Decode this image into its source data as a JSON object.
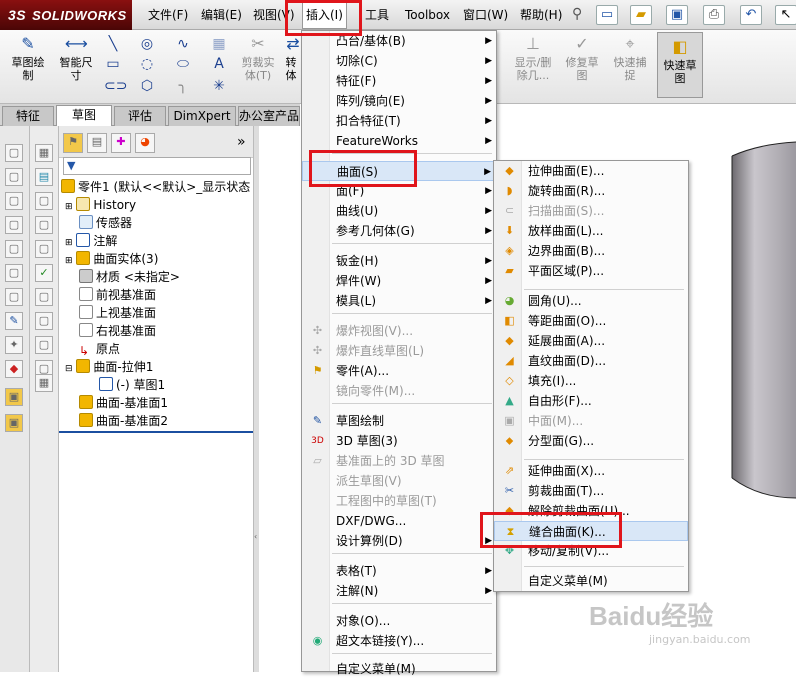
{
  "app": {
    "brand_prefix": "3S",
    "brand": "SOLIDWORKS"
  },
  "menubar": [
    {
      "label": "文件(F)"
    },
    {
      "label": "编辑(E)"
    },
    {
      "label": "视图(V)"
    },
    {
      "label": "插入(I)"
    },
    {
      "label": "工具"
    },
    {
      "label": "Toolbox"
    },
    {
      "label": "窗口(W)"
    },
    {
      "label": "帮助(H)"
    }
  ],
  "commandbar": {
    "sketch": "草图绘\n制",
    "smart_dim": "智能尺\n寸",
    "trim": "剪裁实\n体(T)",
    "convert": "转\n体",
    "show_hide": "显示/删\n除几...",
    "repair_sketch": "修复草\n图",
    "quick_snap": "快速捕\n捉",
    "quick_sketch": "快速草\n图"
  },
  "tabs": [
    {
      "label": "特征"
    },
    {
      "label": "草图"
    },
    {
      "label": "评估"
    },
    {
      "label": "DimXpert"
    },
    {
      "label": "办公室产品"
    }
  ],
  "tree": {
    "root": "零件1 (默认<<默认>_显示状态",
    "items": [
      {
        "label": "History"
      },
      {
        "label": "传感器"
      },
      {
        "label": "注解"
      },
      {
        "label": "曲面实体(3)"
      },
      {
        "label": "材质 <未指定>"
      },
      {
        "label": "前视基准面"
      },
      {
        "label": "上视基准面"
      },
      {
        "label": "右视基准面"
      },
      {
        "label": "原点"
      },
      {
        "label": "曲面-拉伸1"
      },
      {
        "label": "(-) 草图1"
      },
      {
        "label": "曲面-基准面1"
      },
      {
        "label": "曲面-基准面2"
      }
    ]
  },
  "insert_menu": [
    {
      "label": "凸台/基体(B)",
      "sub": true
    },
    {
      "label": "切除(C)",
      "sub": true
    },
    {
      "label": "特征(F)",
      "sub": true
    },
    {
      "label": "阵列/镜向(E)",
      "sub": true
    },
    {
      "label": "扣合特征(T)",
      "sub": true
    },
    {
      "label": "FeatureWorks",
      "sub": true
    },
    {
      "label": "曲面(S)",
      "sub": true
    },
    {
      "label": "面(F)",
      "sub": true
    },
    {
      "label": "曲线(U)",
      "sub": true
    },
    {
      "label": "参考几何体(G)",
      "sub": true
    },
    {
      "label": "钣金(H)",
      "sub": true
    },
    {
      "label": "焊件(W)",
      "sub": true
    },
    {
      "label": "模具(L)",
      "sub": true
    },
    {
      "label": "爆炸视图(V)..."
    },
    {
      "label": "爆炸直线草图(L)"
    },
    {
      "label": "零件(A)..."
    },
    {
      "label": "镜向零件(M)..."
    },
    {
      "label": "草图绘制"
    },
    {
      "label": "3D 草图(3)"
    },
    {
      "label": "基准面上的 3D 草图"
    },
    {
      "label": "派生草图(V)"
    },
    {
      "label": "工程图中的草图(T)"
    },
    {
      "label": "DXF/DWG..."
    },
    {
      "label": "设计算例(D)",
      "sub": true
    },
    {
      "label": "表格(T)",
      "sub": true
    },
    {
      "label": "注解(N)",
      "sub": true
    },
    {
      "label": "对象(O)..."
    },
    {
      "label": "超文本链接(Y)..."
    },
    {
      "label": "自定义菜单(M)"
    }
  ],
  "surface_menu": [
    {
      "label": "拉伸曲面(E)..."
    },
    {
      "label": "旋转曲面(R)..."
    },
    {
      "label": "扫描曲面(S)..."
    },
    {
      "label": "放样曲面(L)..."
    },
    {
      "label": "边界曲面(B)..."
    },
    {
      "label": "平面区域(P)..."
    },
    {
      "label": "圆角(U)..."
    },
    {
      "label": "等距曲面(O)..."
    },
    {
      "label": "延展曲面(A)..."
    },
    {
      "label": "直纹曲面(D)..."
    },
    {
      "label": "填充(I)..."
    },
    {
      "label": "自由形(F)..."
    },
    {
      "label": "中面(M)..."
    },
    {
      "label": "分型面(G)..."
    },
    {
      "label": "延伸曲面(X)..."
    },
    {
      "label": "剪裁曲面(T)..."
    },
    {
      "label": "解除剪裁曲面(U)..."
    },
    {
      "label": "缝合曲面(K)..."
    },
    {
      "label": "移动/复制(V)..."
    },
    {
      "label": "自定义菜单(M)"
    }
  ],
  "watermark": "Baidu经验",
  "watermark_url": "jingyan.baidu.com",
  "colors": {
    "highlight_red": "#e0151b",
    "brand_red": "#8a1010",
    "accent_blue": "#1b4fa0"
  }
}
